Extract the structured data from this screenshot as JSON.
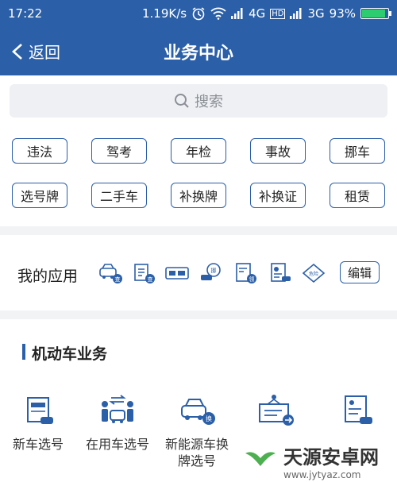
{
  "status_bar": {
    "time": "17:22",
    "speed": "1.19K/s",
    "network_1": "4G",
    "network_1_badge": "HD",
    "network_2": "3G",
    "battery": "93%",
    "battery_level": 0.93
  },
  "header": {
    "back_label": "返回",
    "title": "业务中心"
  },
  "search": {
    "placeholder": "搜索"
  },
  "quick_services": [
    "违法",
    "驾考",
    "年检",
    "事故",
    "挪车",
    "选号牌",
    "二手车",
    "补换牌",
    "补换证",
    "租赁"
  ],
  "my_apps": {
    "label": "我的应用",
    "icons": [
      "car-inspection-icon",
      "document-icon",
      "license-plate-icon",
      "chat-car-icon",
      "registration-icon",
      "driver-license-icon",
      "road-sign-icon"
    ],
    "icon_badges": [
      "查",
      "查",
      "",
      "挪",
      "领",
      "",
      "危险"
    ],
    "edit_label": "编辑"
  },
  "motor_business": {
    "title": "机动车业务",
    "items": [
      {
        "label": "新车选号",
        "icon": "new-car-plate-icon"
      },
      {
        "label": "在用车选号",
        "icon": "used-car-plate-icon"
      },
      {
        "label": "新能源车换牌选号",
        "icon": "ev-plate-icon"
      },
      {
        "label": "",
        "icon": "plate-transfer-icon"
      },
      {
        "label": "",
        "icon": "license-card-icon"
      }
    ]
  },
  "watermark": {
    "text": "天源安卓网",
    "url": "www.jytyaz.com"
  },
  "colors": {
    "primary": "#2b5fa8",
    "battery_fill": "#2ecc71",
    "background": "#f2f3f5"
  }
}
